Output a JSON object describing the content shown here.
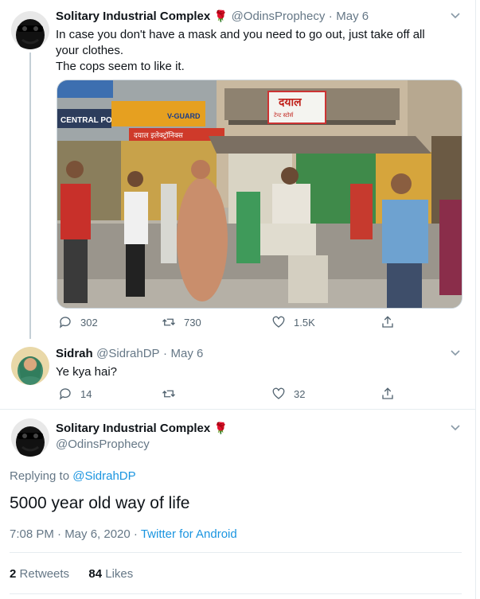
{
  "colors": {
    "link": "#1b95e0",
    "muted": "#657786",
    "rose": "#c8102e"
  },
  "tweet1": {
    "name": "Solitary Industrial Complex",
    "name_emoji": "🌹",
    "handle": "@OdinsProphecy",
    "sep": "·",
    "date": "May 6",
    "text_line1": "In case you don't have a mask and you need to go out, just take off all",
    "text_line2": "your clothes.",
    "text_line3": "The cops seem to like it.",
    "photo": {
      "sign_shop": "दयाल",
      "sign_shop_sub": "टेन्ट स्टोर्स",
      "sign_central": "CENTRAL POIN",
      "sign_vguard": "V-GUARD",
      "sign_store": "दयाल इलेक्ट्रॉनिक्स"
    },
    "replies": "302",
    "retweets": "730",
    "likes": "1.5K"
  },
  "tweet2": {
    "name": "Sidrah",
    "handle": "@SidrahDP",
    "sep": "·",
    "date": "May 6",
    "text": "Ye kya hai?",
    "replies": "14",
    "retweets": "",
    "likes": "32"
  },
  "main": {
    "name": "Solitary Industrial Complex",
    "name_emoji": "🌹",
    "handle": "@OdinsProphecy",
    "replying_prefix": "Replying to",
    "replying_handle": "@SidrahDP",
    "text": "5000 year old way of life",
    "time": "7:08 PM · May 6, 2020",
    "sep": "·",
    "client": "Twitter for Android",
    "retweets_count": "2",
    "retweets_label": "Retweets",
    "likes_count": "84",
    "likes_label": "Likes"
  }
}
